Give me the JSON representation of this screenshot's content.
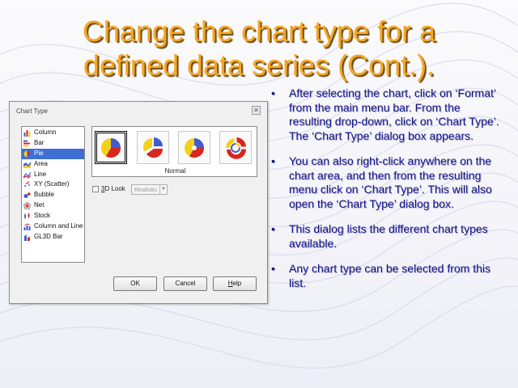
{
  "slide": {
    "title_line1": "Change the chart type for a",
    "title_line2": "defined data series (Cont.)."
  },
  "bullets": [
    "After selecting the chart, click on ‘Format’ from the main menu bar. From the resulting drop-down, click on ‘Chart Type’. The ‘Chart Type’ dialog box appears.",
    "You can also right-click anywhere on the chart area, and then from the resulting menu click on ‘Chart Type’. This will also open the ‘Chart Type’ dialog box.",
    "This dialog lists the different chart types available.",
    "Any chart type can be selected from this list."
  ],
  "bullet_glyph": "•",
  "dialog": {
    "title": "Chart Type",
    "close_glyph": "✕",
    "chart_types": [
      {
        "label": "Column",
        "icon": "column-chart-icon"
      },
      {
        "label": "Bar",
        "icon": "bar-chart-icon"
      },
      {
        "label": "Pie",
        "icon": "pie-chart-icon",
        "selected": true
      },
      {
        "label": "Area",
        "icon": "area-chart-icon"
      },
      {
        "label": "Line",
        "icon": "line-chart-icon"
      },
      {
        "label": "XY (Scatter)",
        "icon": "scatter-chart-icon"
      },
      {
        "label": "Bubble",
        "icon": "bubble-chart-icon"
      },
      {
        "label": "Net",
        "icon": "net-chart-icon"
      },
      {
        "label": "Stock",
        "icon": "stock-chart-icon"
      },
      {
        "label": "Column and Line",
        "icon": "column-line-chart-icon"
      },
      {
        "label": "GL3D Bar",
        "icon": "gl3d-bar-chart-icon"
      }
    ],
    "variant_label": "Normal",
    "look_label_pre": "",
    "look_label_ul": "3",
    "look_label_post": "D Look",
    "look_select_value": "Realistic",
    "ok_label": "OK",
    "cancel_label": "Cancel",
    "help_label_ul": "H",
    "help_label_post": "elp",
    "colors": {
      "pie_blue": "#3f5bd1",
      "pie_red": "#d8261f",
      "pie_yellow": "#f3d11a",
      "title_orange": "#f5a623",
      "bullet_navy": "#13138a"
    }
  }
}
